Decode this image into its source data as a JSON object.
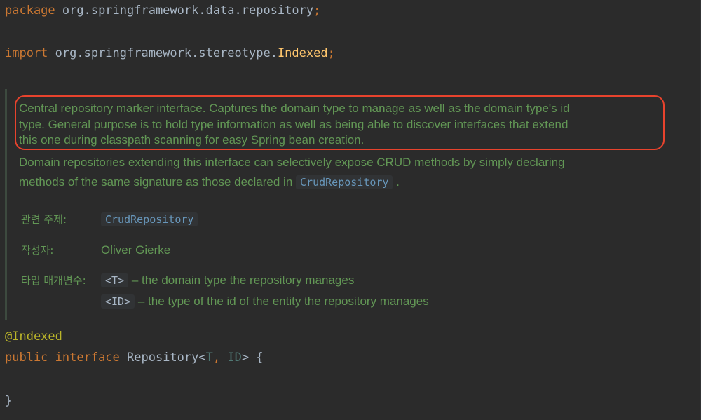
{
  "code": {
    "package_kw": "package",
    "package_name": " org.springframework.data.repository",
    "semicolon": ";",
    "import_kw": "import",
    "import_pkg": " org.springframework.stereotype.",
    "import_class": "Indexed",
    "annotation": "@Indexed",
    "public_kw": "public",
    "interface_kw": " interface",
    "type_name": " Repository<",
    "type_param_t": "T",
    "comma": ",",
    "type_param_id": " ID",
    "type_close": "> {",
    "close_brace": "}"
  },
  "javadoc": {
    "highlighted_lines": [
      "Central repository marker interface. Captures the domain type to manage as well as the domain type's id",
      "type. General purpose is to hold type information as well as being able to discover interfaces that extend",
      "this one during classpath scanning for easy Spring bean creation."
    ],
    "line4": "Domain repositories extending this interface can selectively expose CRUD methods by simply declaring",
    "line5_prefix": "methods of the same signature as those declared in ",
    "line5_link": "CrudRepository",
    "line5_suffix": " .",
    "see_label": "관련 주제:",
    "see_link": "CrudRepository",
    "author_label": "작성자:",
    "author_value": "Oliver Gierke",
    "param_label": "타입 매개변수:",
    "param_t_name": "<T>",
    "param_t_desc": " – the domain type the repository manages",
    "param_id_name": "<ID>",
    "param_id_desc": " – the type of the id of the entity the repository manages"
  },
  "colors": {
    "background": "#2b2b2b",
    "keyword": "#cc7832",
    "doc_text": "#629755",
    "link": "#6897bb",
    "annotation": "#bbb529",
    "class_name": "#ffc66d",
    "highlight_border": "#e8432d"
  }
}
